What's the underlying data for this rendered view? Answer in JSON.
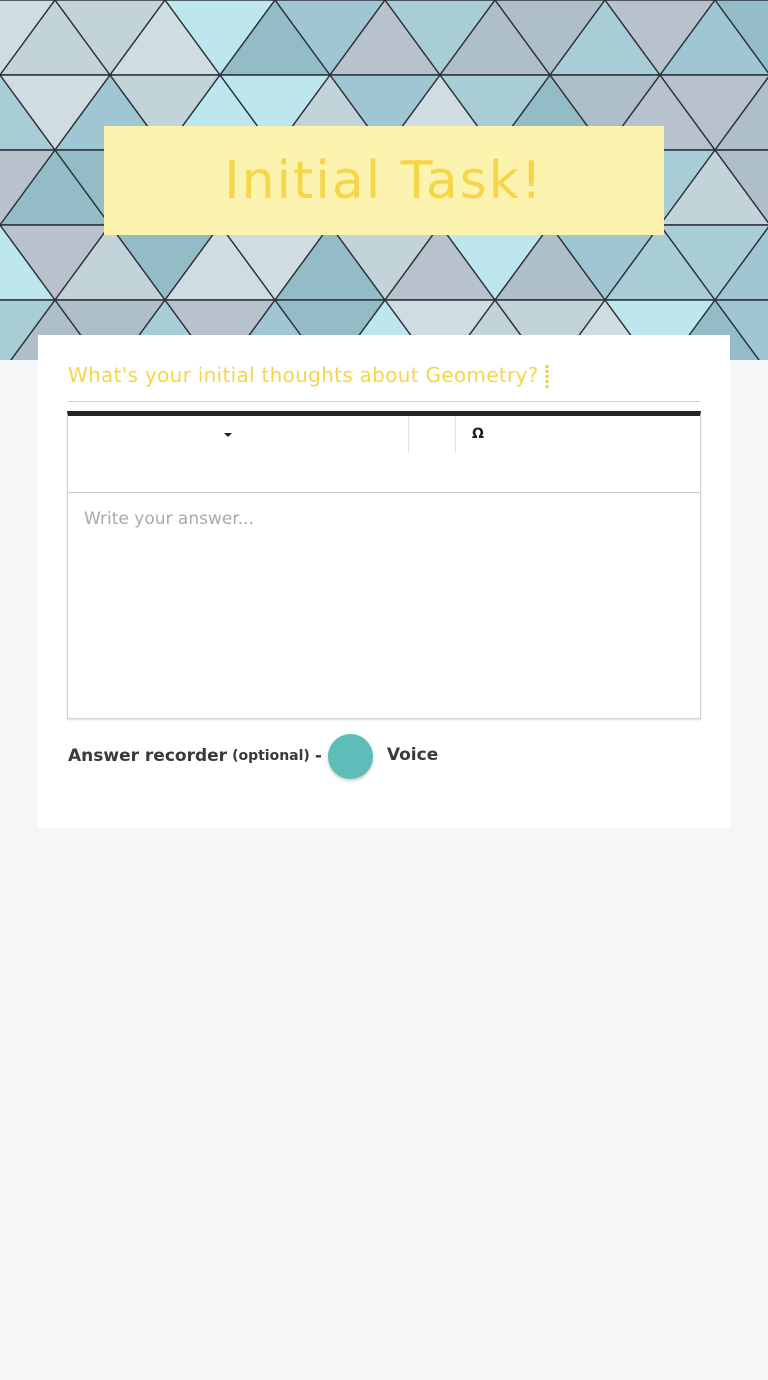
{
  "header": {
    "title": "Initial Task!",
    "title_color": "#f5d54a",
    "title_box_color": "#fcf3ae"
  },
  "question": {
    "text": "What's your initial thoughts about  Geometry?"
  },
  "editor": {
    "special_char_glyph": "Ω",
    "answer_placeholder": "Write your answer...",
    "answer_value": ""
  },
  "recorder": {
    "label": "Answer recorder",
    "optional": "(optional)",
    "dash": "-",
    "voice_label": "Voice",
    "button_color": "#5ebdb9"
  },
  "colors": {
    "background": "#f5f6f8",
    "accent_yellow": "#f5d54a",
    "toolbar_border": "#222428"
  }
}
